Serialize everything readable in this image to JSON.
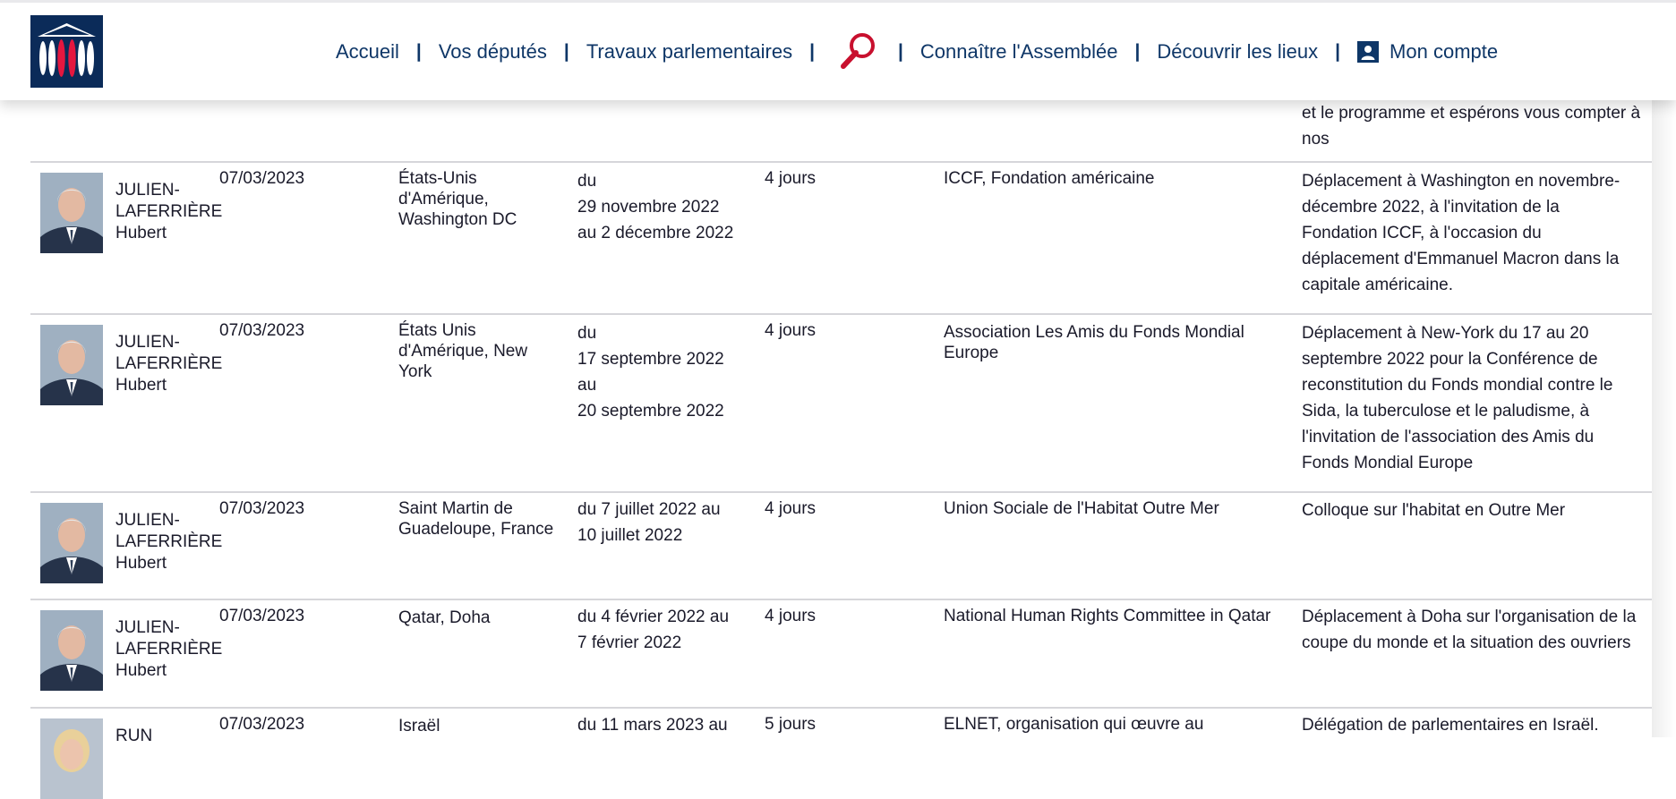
{
  "header": {
    "nav": [
      {
        "label": "Accueil"
      },
      {
        "label": "Vos députés"
      },
      {
        "label": "Travaux parlementaires"
      },
      {
        "label": "Connaître l'Assemblée"
      },
      {
        "label": "Découvrir les lieux"
      }
    ],
    "account_label": "Mon compte"
  },
  "partial_row": {
    "lines": [
      "et le programme et espérons vous compter à",
      "nos"
    ]
  },
  "rows": [
    {
      "name": [
        "JULIEN-",
        "LAFERRIÈRE",
        "Hubert"
      ],
      "date": "07/03/2023",
      "destination": [
        "États-Unis",
        "d'Amérique,",
        "Washington DC"
      ],
      "period": [
        "du",
        "29 novembre 2022",
        "au 2 décembre 2022"
      ],
      "duration": "4 jours",
      "organizer": [
        "ICCF, Fondation américaine"
      ],
      "purpose": [
        "Déplacement à Washington en novembre-",
        "décembre 2022, à l'invitation de la",
        "Fondation ICCF, à l'occasion du",
        "déplacement d'Emmanuel Macron dans la",
        "capitale américaine."
      ]
    },
    {
      "name": [
        "JULIEN-",
        "LAFERRIÈRE",
        "Hubert"
      ],
      "date": "07/03/2023",
      "destination": [
        "États Unis",
        "d'Amérique, New",
        "York"
      ],
      "period": [
        "du",
        "17 septembre 2022",
        "au",
        "20 septembre 2022"
      ],
      "duration": "4 jours",
      "organizer": [
        "Association Les Amis du Fonds Mondial",
        "Europe"
      ],
      "purpose": [
        "Déplacement à New-York du 17 au 20",
        "septembre 2022 pour la Conférence de",
        "reconstitution du Fonds mondial contre le",
        "Sida, la tuberculose et le paludisme, à",
        "l'invitation de l'association des Amis du",
        "Fonds Mondial Europe"
      ]
    },
    {
      "name": [
        "JULIEN-",
        "LAFERRIÈRE",
        "Hubert"
      ],
      "date": "07/03/2023",
      "destination": [
        "Saint Martin de",
        "Guadeloupe, France"
      ],
      "period": [
        "du 7 juillet 2022 au",
        "10 juillet 2022"
      ],
      "duration": "4 jours",
      "organizer": [
        "Union Sociale de l'Habitat Outre Mer"
      ],
      "purpose": [
        "Colloque sur l'habitat en Outre Mer"
      ]
    },
    {
      "name": [
        "JULIEN-",
        "LAFERRIÈRE",
        "Hubert"
      ],
      "date": "07/03/2023",
      "destination": [
        "Qatar, Doha"
      ],
      "period": [
        "du 4 février 2022 au",
        "7 février 2022"
      ],
      "duration": "4 jours",
      "organizer": [
        "National Human Rights Committee in Qatar"
      ],
      "purpose": [
        "Déplacement à Doha sur l'organisation de la",
        "coupe du monde et la situation des ouvriers"
      ]
    },
    {
      "name": [
        "RUN"
      ],
      "date": "07/03/2023",
      "destination": [
        "Israël"
      ],
      "period": [
        "du 11 mars 2023 au"
      ],
      "duration": "5 jours",
      "organizer": [
        "ELNET, organisation qui œuvre au"
      ],
      "purpose": [
        "Délégation de parlementaires en Israël."
      ]
    }
  ],
  "colors": {
    "nav_text": "#0e3667",
    "logo_bg": "#0b2b59",
    "accent_red": "#c8102e",
    "row_border": "#d6d6da"
  }
}
